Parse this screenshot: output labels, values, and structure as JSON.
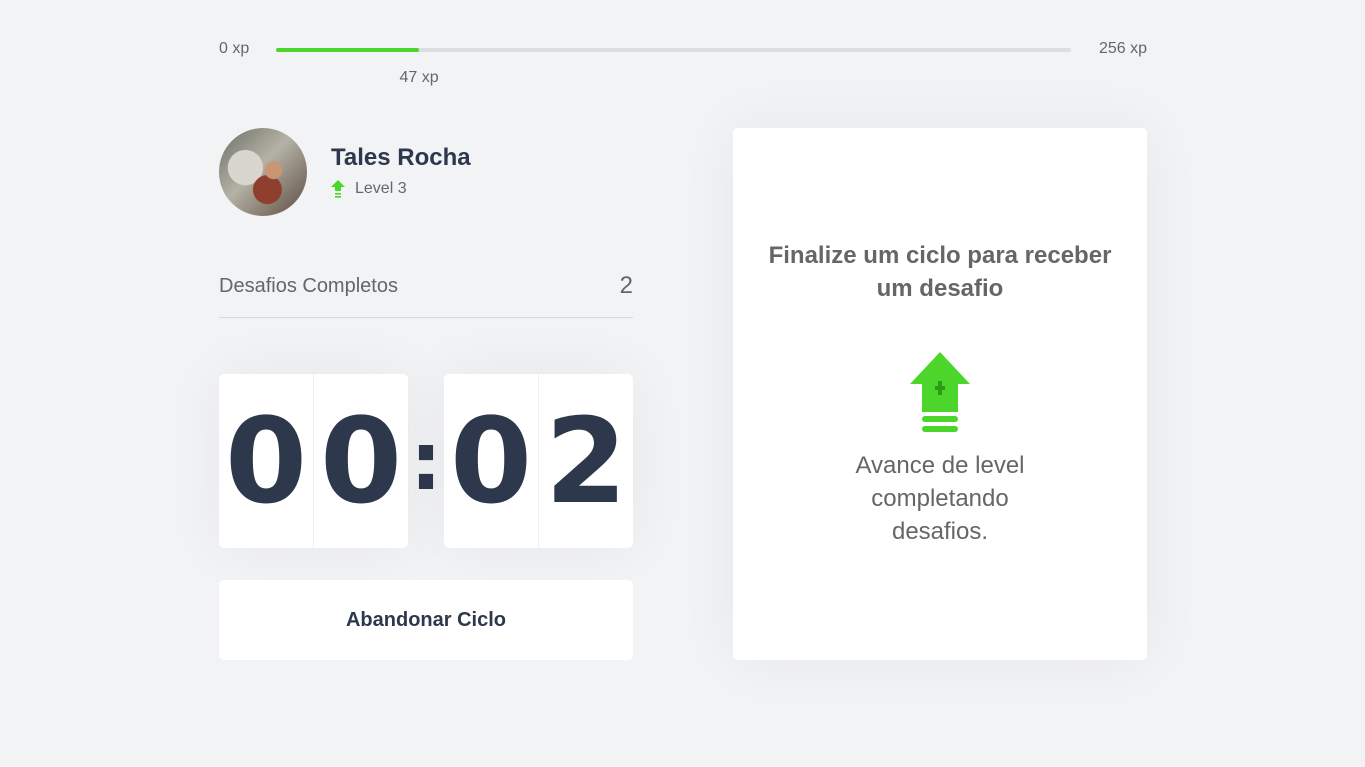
{
  "experience": {
    "min_label": "0 xp",
    "max_label": "256 xp",
    "current_label": "47 xp",
    "progress_fraction": 0.18
  },
  "profile": {
    "name": "Tales Rocha",
    "level_label": "Level 3",
    "level_icon": "level-up-arrow-icon"
  },
  "challenges": {
    "completed_label": "Desafios Completos",
    "completed_count": "2"
  },
  "countdown": {
    "minute_left": "0",
    "minute_right": "0",
    "separator": ":",
    "second_left": "0",
    "second_right": "2"
  },
  "actions": {
    "abandon_label": "Abandonar Ciclo"
  },
  "challenge_box": {
    "title": "Finalize um ciclo para receber um desafio",
    "icon": "level-up-arrow-icon",
    "message": "Avance de level completando desafios."
  },
  "colors": {
    "accent_green": "#4cd62b",
    "text_dark": "#2e384d",
    "text": "#666666",
    "background": "#f2f3f5"
  }
}
